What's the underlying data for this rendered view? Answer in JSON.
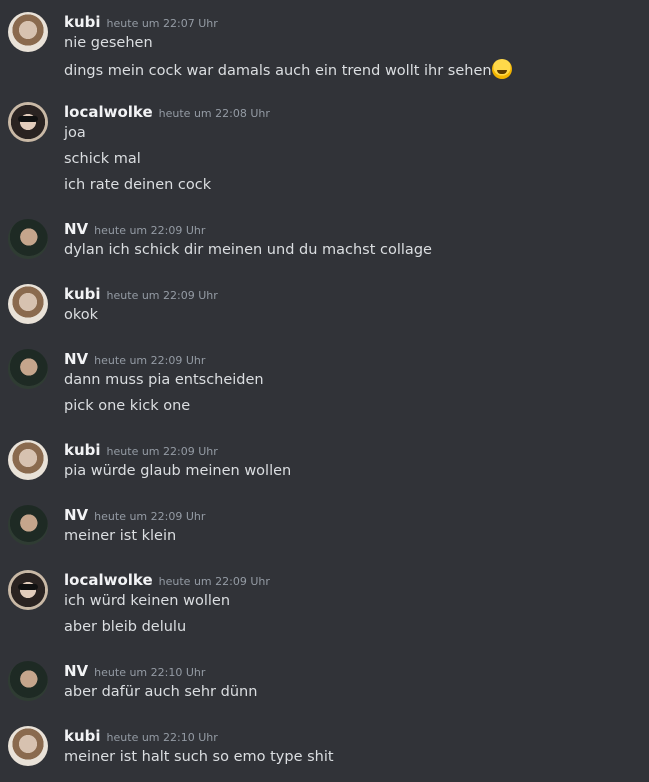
{
  "messages": [
    {
      "author": "kubi",
      "avatar": "kubi-avatar",
      "timestamp": "heute um 22:07 Uhr",
      "lines": [
        "nie gesehen",
        "dings mein cock war damals auch ein trend wollt ihr sehen"
      ],
      "emoji": "sweat-smile-emoji"
    },
    {
      "author": "localwolke",
      "avatar": "localwolke-avatar",
      "timestamp": "heute um 22:08 Uhr",
      "lines": [
        "joa",
        "schick mal",
        "ich rate deinen cock"
      ]
    },
    {
      "author": "NV",
      "avatar": "nv-avatar",
      "timestamp": "heute um 22:09 Uhr",
      "lines": [
        "dylan ich schick dir meinen und du machst collage"
      ]
    },
    {
      "author": "kubi",
      "avatar": "kubi-avatar",
      "timestamp": "heute um 22:09 Uhr",
      "lines": [
        "okok"
      ]
    },
    {
      "author": "NV",
      "avatar": "nv-avatar",
      "timestamp": "heute um 22:09 Uhr",
      "lines": [
        "dann muss pia entscheiden",
        "pick one kick one"
      ]
    },
    {
      "author": "kubi",
      "avatar": "kubi-avatar",
      "timestamp": "heute um 22:09 Uhr",
      "lines": [
        "pia würde glaub meinen wollen"
      ]
    },
    {
      "author": "NV",
      "avatar": "nv-avatar",
      "timestamp": "heute um 22:09 Uhr",
      "lines": [
        "meiner ist klein"
      ]
    },
    {
      "author": "localwolke",
      "avatar": "localwolke-avatar",
      "timestamp": "heute um 22:09 Uhr",
      "lines": [
        "ich würd keinen wollen",
        "aber bleib delulu"
      ]
    },
    {
      "author": "NV",
      "avatar": "nv-avatar",
      "timestamp": "heute um 22:10 Uhr",
      "lines": [
        "aber dafür auch sehr dünn"
      ]
    },
    {
      "author": "kubi",
      "avatar": "kubi-avatar",
      "timestamp": "heute um 22:10 Uhr",
      "lines": [
        "meiner ist halt such so emo type shit"
      ]
    }
  ]
}
